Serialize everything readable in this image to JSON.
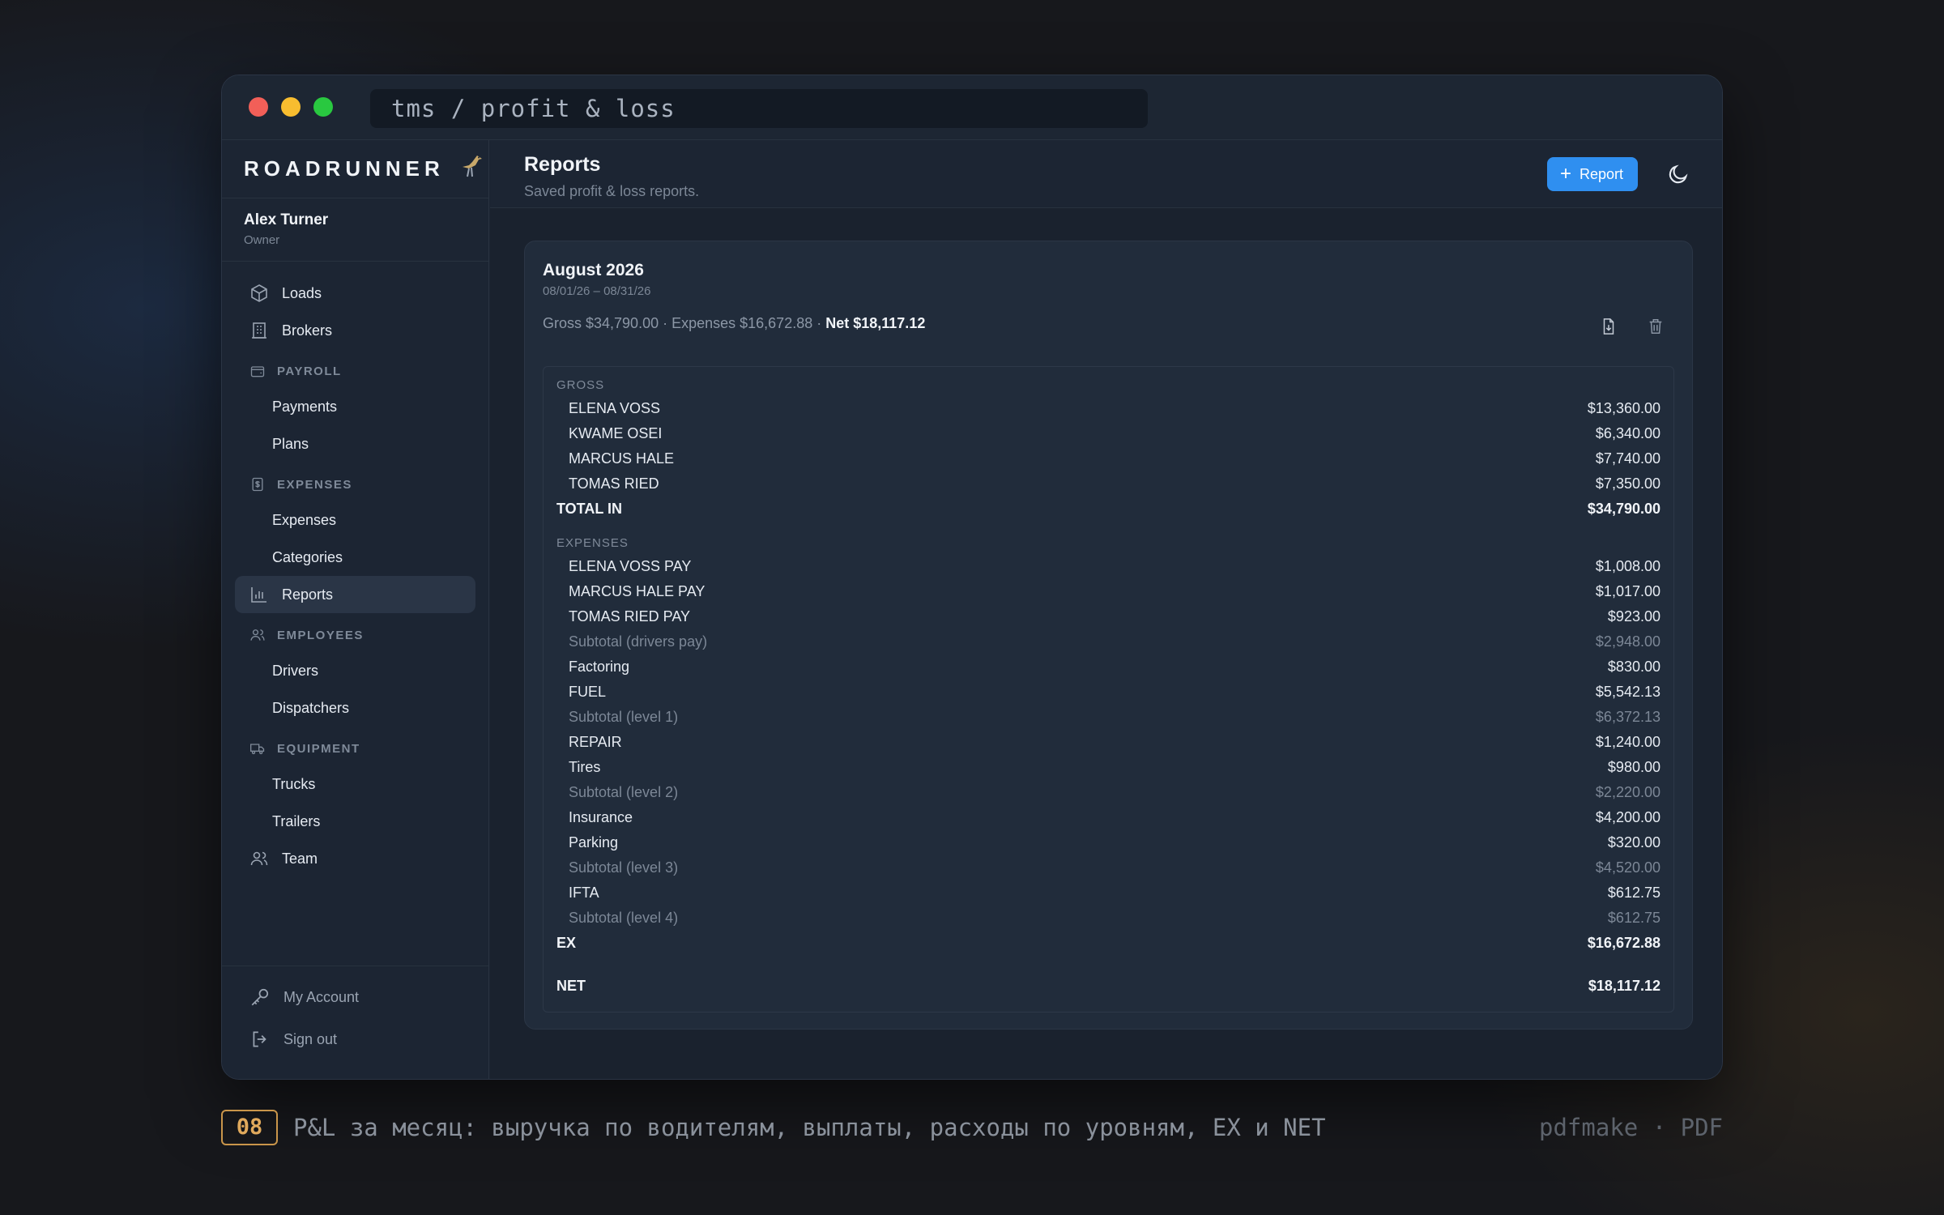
{
  "window": {
    "url": "tms / profit & loss"
  },
  "brand": {
    "name": "ROADRUNNER",
    "logo_icon": "roadrunner-bird"
  },
  "user": {
    "name": "Alex Turner",
    "role": "Owner"
  },
  "nav": {
    "loads": "Loads",
    "brokers": "Brokers",
    "payroll": "PAYROLL",
    "payments": "Payments",
    "plans": "Plans",
    "expenses_section": "EXPENSES",
    "expenses": "Expenses",
    "categories": "Categories",
    "reports": "Reports",
    "employees": "EMPLOYEES",
    "drivers": "Drivers",
    "dispatchers": "Dispatchers",
    "equipment": "EQUIPMENT",
    "trucks": "Trucks",
    "trailers": "Trailers",
    "team": "Team"
  },
  "footer": {
    "account": "My Account",
    "signout": "Sign out"
  },
  "header": {
    "title": "Reports",
    "subtitle": "Saved profit & loss reports.",
    "add_button": "Report"
  },
  "report": {
    "title": "August 2026",
    "range": "08/01/26 – 08/31/26",
    "summary_gross": "Gross $34,790.00 · Expenses $16,672.88 · ",
    "summary_net": "Net $18,117.12",
    "gross_label": "GROSS",
    "gross_rows": [
      {
        "label": "ELENA VOSS",
        "amount": "$13,360.00"
      },
      {
        "label": "KWAME OSEI",
        "amount": "$6,340.00"
      },
      {
        "label": "MARCUS HALE",
        "amount": "$7,740.00"
      },
      {
        "label": "TOMAS RIED",
        "amount": "$7,350.00"
      }
    ],
    "total_in": {
      "label": "TOTAL IN",
      "amount": "$34,790.00"
    },
    "expenses_label": "EXPENSES",
    "expense_rows": [
      {
        "label": "ELENA VOSS PAY",
        "amount": "$1,008.00",
        "kind": "item"
      },
      {
        "label": "MARCUS HALE PAY",
        "amount": "$1,017.00",
        "kind": "item"
      },
      {
        "label": "TOMAS RIED PAY",
        "amount": "$923.00",
        "kind": "item"
      },
      {
        "label": "Subtotal (drivers pay)",
        "amount": "$2,948.00",
        "kind": "sub"
      },
      {
        "label": "Factoring",
        "amount": "$830.00",
        "kind": "item"
      },
      {
        "label": "FUEL",
        "amount": "$5,542.13",
        "kind": "item"
      },
      {
        "label": "Subtotal (level 1)",
        "amount": "$6,372.13",
        "kind": "sub"
      },
      {
        "label": "REPAIR",
        "amount": "$1,240.00",
        "kind": "item"
      },
      {
        "label": "Tires",
        "amount": "$980.00",
        "kind": "item"
      },
      {
        "label": "Subtotal (level 2)",
        "amount": "$2,220.00",
        "kind": "sub"
      },
      {
        "label": "Insurance",
        "amount": "$4,200.00",
        "kind": "item"
      },
      {
        "label": "Parking",
        "amount": "$320.00",
        "kind": "item"
      },
      {
        "label": "Subtotal (level 3)",
        "amount": "$4,520.00",
        "kind": "sub"
      },
      {
        "label": "IFTA",
        "amount": "$612.75",
        "kind": "item"
      },
      {
        "label": "Subtotal (level 4)",
        "amount": "$612.75",
        "kind": "sub"
      }
    ],
    "ex": {
      "label": "EX",
      "amount": "$16,672.88"
    },
    "net": {
      "label": "NET",
      "amount": "$18,117.12"
    }
  },
  "caption": {
    "number": "08",
    "text": "P&L за месяц: выручка по водителям, выплаты, расходы по уровням, EX и NET",
    "right": "pdfmake · PDF"
  },
  "colors": {
    "accent": "#2f8ff0",
    "background": "#1a222e",
    "sidebar": "#1c2533",
    "card": "#212c3b"
  }
}
